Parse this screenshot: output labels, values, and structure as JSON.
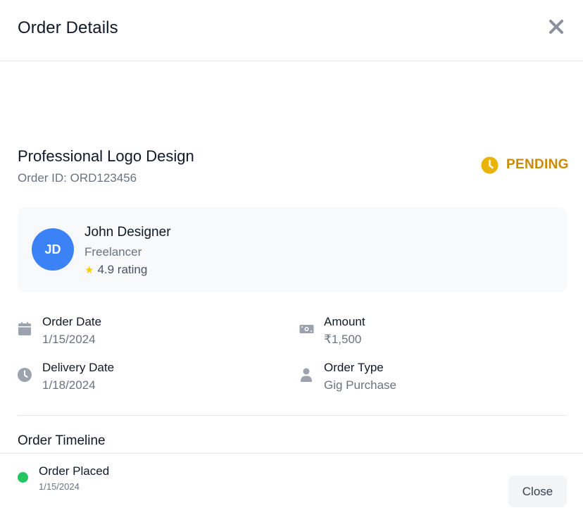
{
  "header": {
    "title": "Order Details",
    "close_icon": "close-icon"
  },
  "order": {
    "gig_title": "Professional Logo Design",
    "order_id": "Order ID: ORD123456",
    "status": "PENDING",
    "status_icon": "clock-icon",
    "status_color": "#ca8a04"
  },
  "seller": {
    "initials": "JD",
    "name": "John Designer",
    "role": "Freelancer",
    "rating_icon": "star-icon",
    "rating": "4.9 rating",
    "avatar_color": "#3b82f6"
  },
  "details": {
    "order_date": {
      "label": "Order Date",
      "value": "1/15/2024",
      "icon": "calendar-icon"
    },
    "amount": {
      "label": "Amount",
      "value": "₹1,500",
      "icon": "money-icon"
    },
    "delivery_date": {
      "label": "Delivery Date",
      "value": "1/18/2024",
      "icon": "clock-icon"
    },
    "order_type": {
      "label": "Order Type",
      "value": "Gig Purchase",
      "icon": "user-icon"
    }
  },
  "timeline": {
    "title": "Order Timeline",
    "events": [
      {
        "label": "Order Placed",
        "date": "1/15/2024",
        "dot_color": "#22c55e"
      }
    ]
  },
  "footer": {
    "close_label": "Close"
  }
}
